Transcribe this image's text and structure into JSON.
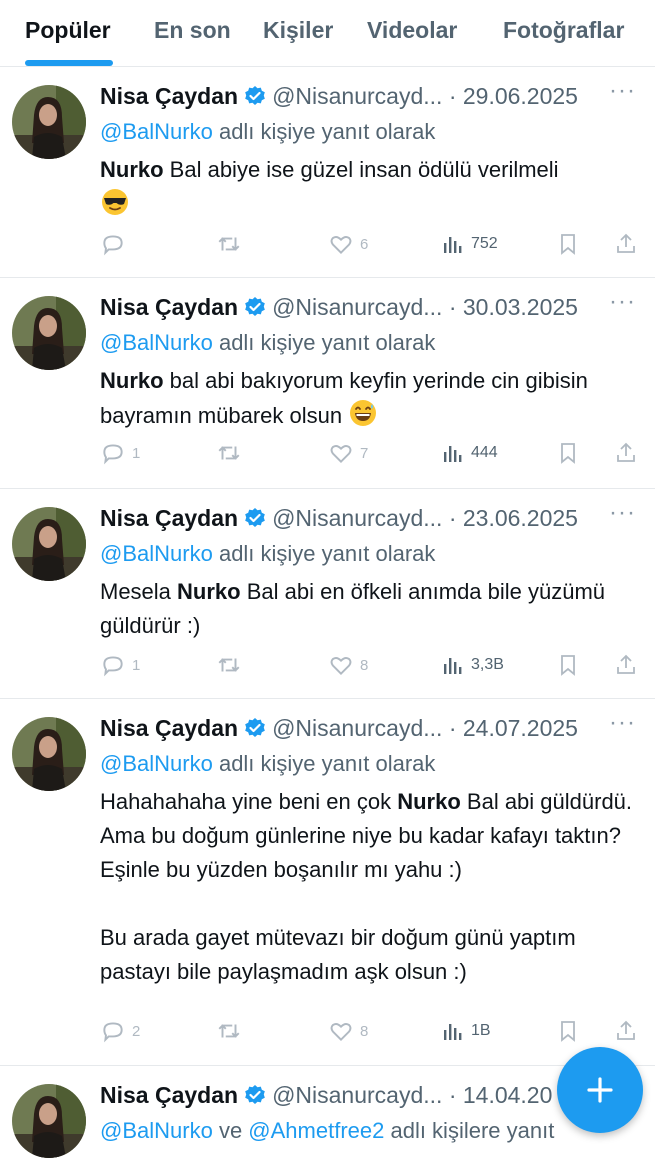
{
  "tabs": [
    "Popüler",
    "En son",
    "Kişiler",
    "Videolar",
    "Fotoğraflar"
  ],
  "reply_suffix": "adlı kişiye yanıt olarak",
  "tweets": [
    {
      "name": "Nisa Çaydan",
      "handle": "@Nisanurcayd...",
      "date": "· 29.06.2025",
      "reply_to": "@BalNurko",
      "body_bold": "Nurko",
      "body_rest": " Bal abiye ise güzel insan ödülü verilmeli",
      "emoji": "sunglasses-emoji",
      "replies": "",
      "likes": "6",
      "views": "752"
    },
    {
      "name": "Nisa Çaydan",
      "handle": "@Nisanurcayd...",
      "date": "· 30.03.2025",
      "reply_to": "@BalNurko",
      "body_bold": "Nurko",
      "body_rest": " bal abi bakıyorum keyfin yerinde cin gibisin bayramın mübarek olsun",
      "emoji": "grinning-sweat-emoji",
      "replies": "1",
      "likes": "7",
      "views": "444"
    },
    {
      "name": "Nisa Çaydan",
      "handle": "@Nisanurcayd...",
      "date": "· 23.06.2025",
      "reply_to": "@BalNurko",
      "body_pre": "Mesela ",
      "body_bold": "Nurko",
      "body_rest": " Bal abi en öfkeli anımda bile yüzümü güldürür :)",
      "replies": "1",
      "likes": "8",
      "views": "3,3B"
    },
    {
      "name": "Nisa Çaydan",
      "handle": "@Nisanurcayd...",
      "date": "· 24.07.2025",
      "reply_to": "@BalNurko",
      "body_pre": "Hahahahaha yine beni en çok ",
      "body_bold": "Nurko",
      "body_rest": " Bal abi güldürdü. Ama bu doğum günlerine niye bu kadar kafayı taktın? Eşinle bu yüzden boşanılır mı yahu :)",
      "body_para2": "Bu arada gayet mütevazı bir doğum günü yaptım pastayı bile paylaşmadım aşk olsun :)",
      "replies": "2",
      "likes": "8",
      "views": "1B"
    },
    {
      "name": "Nisa Çaydan",
      "handle": "@Nisanurcayd...",
      "date": "· 14.04.20",
      "reply_to": "@BalNurko",
      "reply_and": " ve ",
      "reply_to2": "@Ahmetfree2",
      "reply_suffix_plural": " adlı kişilere yanıt"
    }
  ],
  "fab_icon": "plus-icon",
  "colors": {
    "accent": "#1d9bf0",
    "text": "#0f1419",
    "muted": "#536471",
    "icon_faint": "#b0b9c2"
  }
}
